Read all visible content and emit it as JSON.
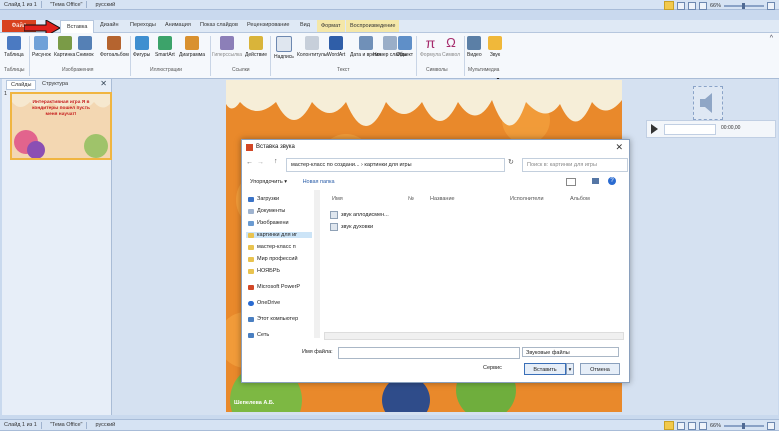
{
  "status_top": {
    "slide": "Слайд 1 из 1",
    "theme": "\"Тема Office\"",
    "lang": "русский",
    "zoom": "66%"
  },
  "status_bottom": {
    "slide": "Слайд 1 из 1",
    "theme": "\"Тема Office\"",
    "lang": "русский",
    "zoom": "66%"
  },
  "tabs": {
    "file": "Файл",
    "insert": "Вставка",
    "design": "Дизайн",
    "transitions": "Переходы",
    "animation": "Анимация",
    "slideshow": "Показ слайдов",
    "review": "Рецензирование",
    "view": "Вид",
    "format": "Формат",
    "playback": "Воспроизведение"
  },
  "ribbon": {
    "table": "Таблица",
    "picture": "Рисунок",
    "clipart": "Картинка",
    "screenshot": "Снимок",
    "album": "Фотоальбом",
    "shapes": "Фигуры",
    "smartart": "SmartArt",
    "chart": "Диаграмма",
    "hyperlink": "Гиперссылка",
    "action": "Действие",
    "textbox": "Надпись",
    "headerfooter": "Колонтитулы",
    "wordart": "WordArt",
    "datetime": "Дата и время",
    "slidenum": "Номер слайда",
    "object": "Объект",
    "formula": "Формула",
    "symbol": "Символ",
    "video": "Видео",
    "audio": "Звук",
    "g_tables": "Таблицы",
    "g_images": "Изображения",
    "g_illustr": "Иллюстрации",
    "g_links": "Ссылки",
    "g_text": "Текст",
    "g_symbols": "Символы",
    "g_media": "Мультимедиа"
  },
  "leftpanel": {
    "tab_slides": "Слайды",
    "tab_outline": "Структура",
    "num": "1",
    "thumb_text": "Интерактивная игра Я в кондитеры пошел пусть меня научат!"
  },
  "player": {
    "time": "00:00,00"
  },
  "dialog": {
    "title": "Вставка звука",
    "path": "мастер-класс по создани...  ›  картинки для игры",
    "search": "Поиск в: картинки для игры",
    "organize": "Упорядочить ▾",
    "newfolder": "Новая папка",
    "nav": [
      "Загрузки",
      "Документы",
      "Изображени",
      "картинки для иг",
      "мастер-класс п",
      "Мир профессий",
      "НОЯБРЬ",
      "Microsoft PowerP",
      "OneDrive",
      "Этот компьютер",
      "Сеть"
    ],
    "cols": {
      "name": "Имя",
      "num": "№",
      "title": "Название",
      "artist": "Исполнители",
      "album": "Альбом"
    },
    "files": [
      "звук аплодисмен...",
      "звук духовки"
    ],
    "fname_label": "Имя файла:",
    "ftype": "Звуковые файлы",
    "service": "Сервис",
    "insert": "Вставить",
    "cancel": "Отмена"
  },
  "slide": {
    "author": "Шепелева А.Б."
  },
  "colors": {
    "file_tab": "#d8421f",
    "arrow": "#e0211b",
    "slide_bg": "#e9892b"
  }
}
